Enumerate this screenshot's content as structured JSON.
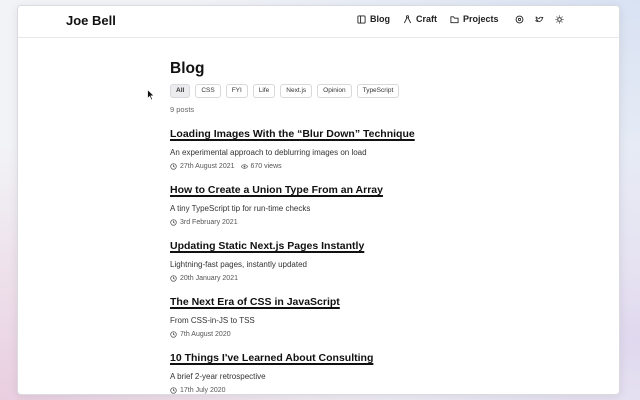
{
  "header": {
    "brand": "Joe Bell",
    "nav": [
      {
        "label": "Blog",
        "icon": "book-icon"
      },
      {
        "label": "Craft",
        "icon": "compass-icon"
      },
      {
        "label": "Projects",
        "icon": "folder-icon"
      }
    ],
    "social_icons": [
      "threads-icon",
      "twitter-icon",
      "sun-icon"
    ]
  },
  "page": {
    "title": "Blog",
    "tags": [
      "All",
      "CSS",
      "FYI",
      "Life",
      "Next.js",
      "Opinion",
      "TypeScript"
    ],
    "active_tag": "All",
    "post_count": "9 posts"
  },
  "posts": [
    {
      "title": "Loading Images With the “Blur Down” Technique",
      "description": "An experimental approach to deblurring images on load",
      "date": "27th August 2021",
      "views": "670 views"
    },
    {
      "title": "How to Create a Union Type From an Array",
      "description": "A tiny TypeScript tip for run-time checks",
      "date": "3rd February 2021"
    },
    {
      "title": "Updating Static Next.js Pages Instantly",
      "description": "Lightning-fast pages, instantly updated",
      "date": "20th January 2021"
    },
    {
      "title": "The Next Era of CSS in JavaScript",
      "description": "From CSS-in-JS to TSS",
      "date": "7th August 2020"
    },
    {
      "title": "10 Things I've Learned About Consulting",
      "description": "A brief 2-year retrospective",
      "date": "17th July 2020"
    }
  ]
}
